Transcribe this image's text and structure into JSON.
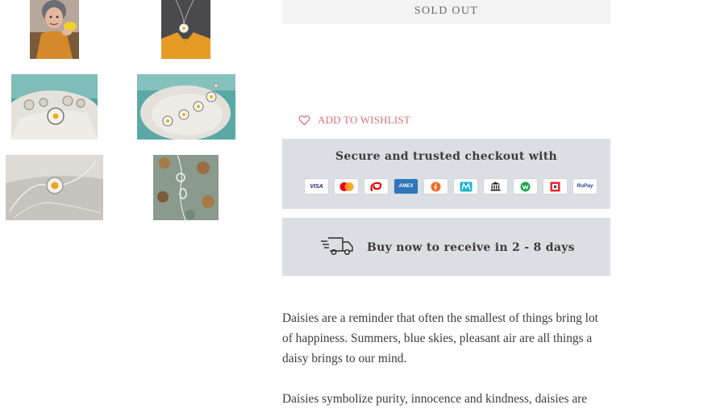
{
  "product": {
    "sold_out_label": "SOLD OUT",
    "wishlist_label": "ADD TO WISHLIST",
    "description": [
      "Daisies are a reminder that often the smallest of things bring lot of happiness. Summers, blue skies, pleasant air are all things a daisy brings to our mind.",
      "Daisies symbolize purity, innocence and kindness, daisies are"
    ]
  },
  "gallery": {
    "thumbnails": [
      "product-photo-model-wearing",
      "product-photo-pendant-on-jacket",
      "product-photo-earrings-set",
      "product-photo-pendants-arranged",
      "product-photo-necklace-chain",
      "product-photo-clasp-closeup"
    ]
  },
  "checkout": {
    "title": "Secure and trusted checkout with",
    "methods": [
      {
        "name": "visa",
        "label": "VISA",
        "color": "#1a1f71"
      },
      {
        "name": "mastercard",
        "label": "",
        "color": "#eb001b"
      },
      {
        "name": "airtel",
        "label": "",
        "color": "#e40000"
      },
      {
        "name": "amex",
        "label": "AMEX",
        "color": "#2e77bb"
      },
      {
        "name": "freecharge",
        "label": "",
        "color": "#f26722"
      },
      {
        "name": "mobikwik",
        "label": "",
        "color": "#17b5c9"
      },
      {
        "name": "netbanking",
        "label": "",
        "color": "#222222"
      },
      {
        "name": "wallet",
        "label": "",
        "color": "#1aa64b"
      },
      {
        "name": "hdfc",
        "label": "",
        "color": "#ed232a"
      },
      {
        "name": "rupay",
        "label": "RuPay",
        "color": "#1c3f94"
      }
    ]
  },
  "delivery": {
    "text": "Buy now to receive in 2 - 8 days",
    "icon": "truck-icon"
  },
  "colors": {
    "accent": "#d9717d",
    "panel": "#dbdee2",
    "sold_out_bg": "#f3f3f3"
  }
}
